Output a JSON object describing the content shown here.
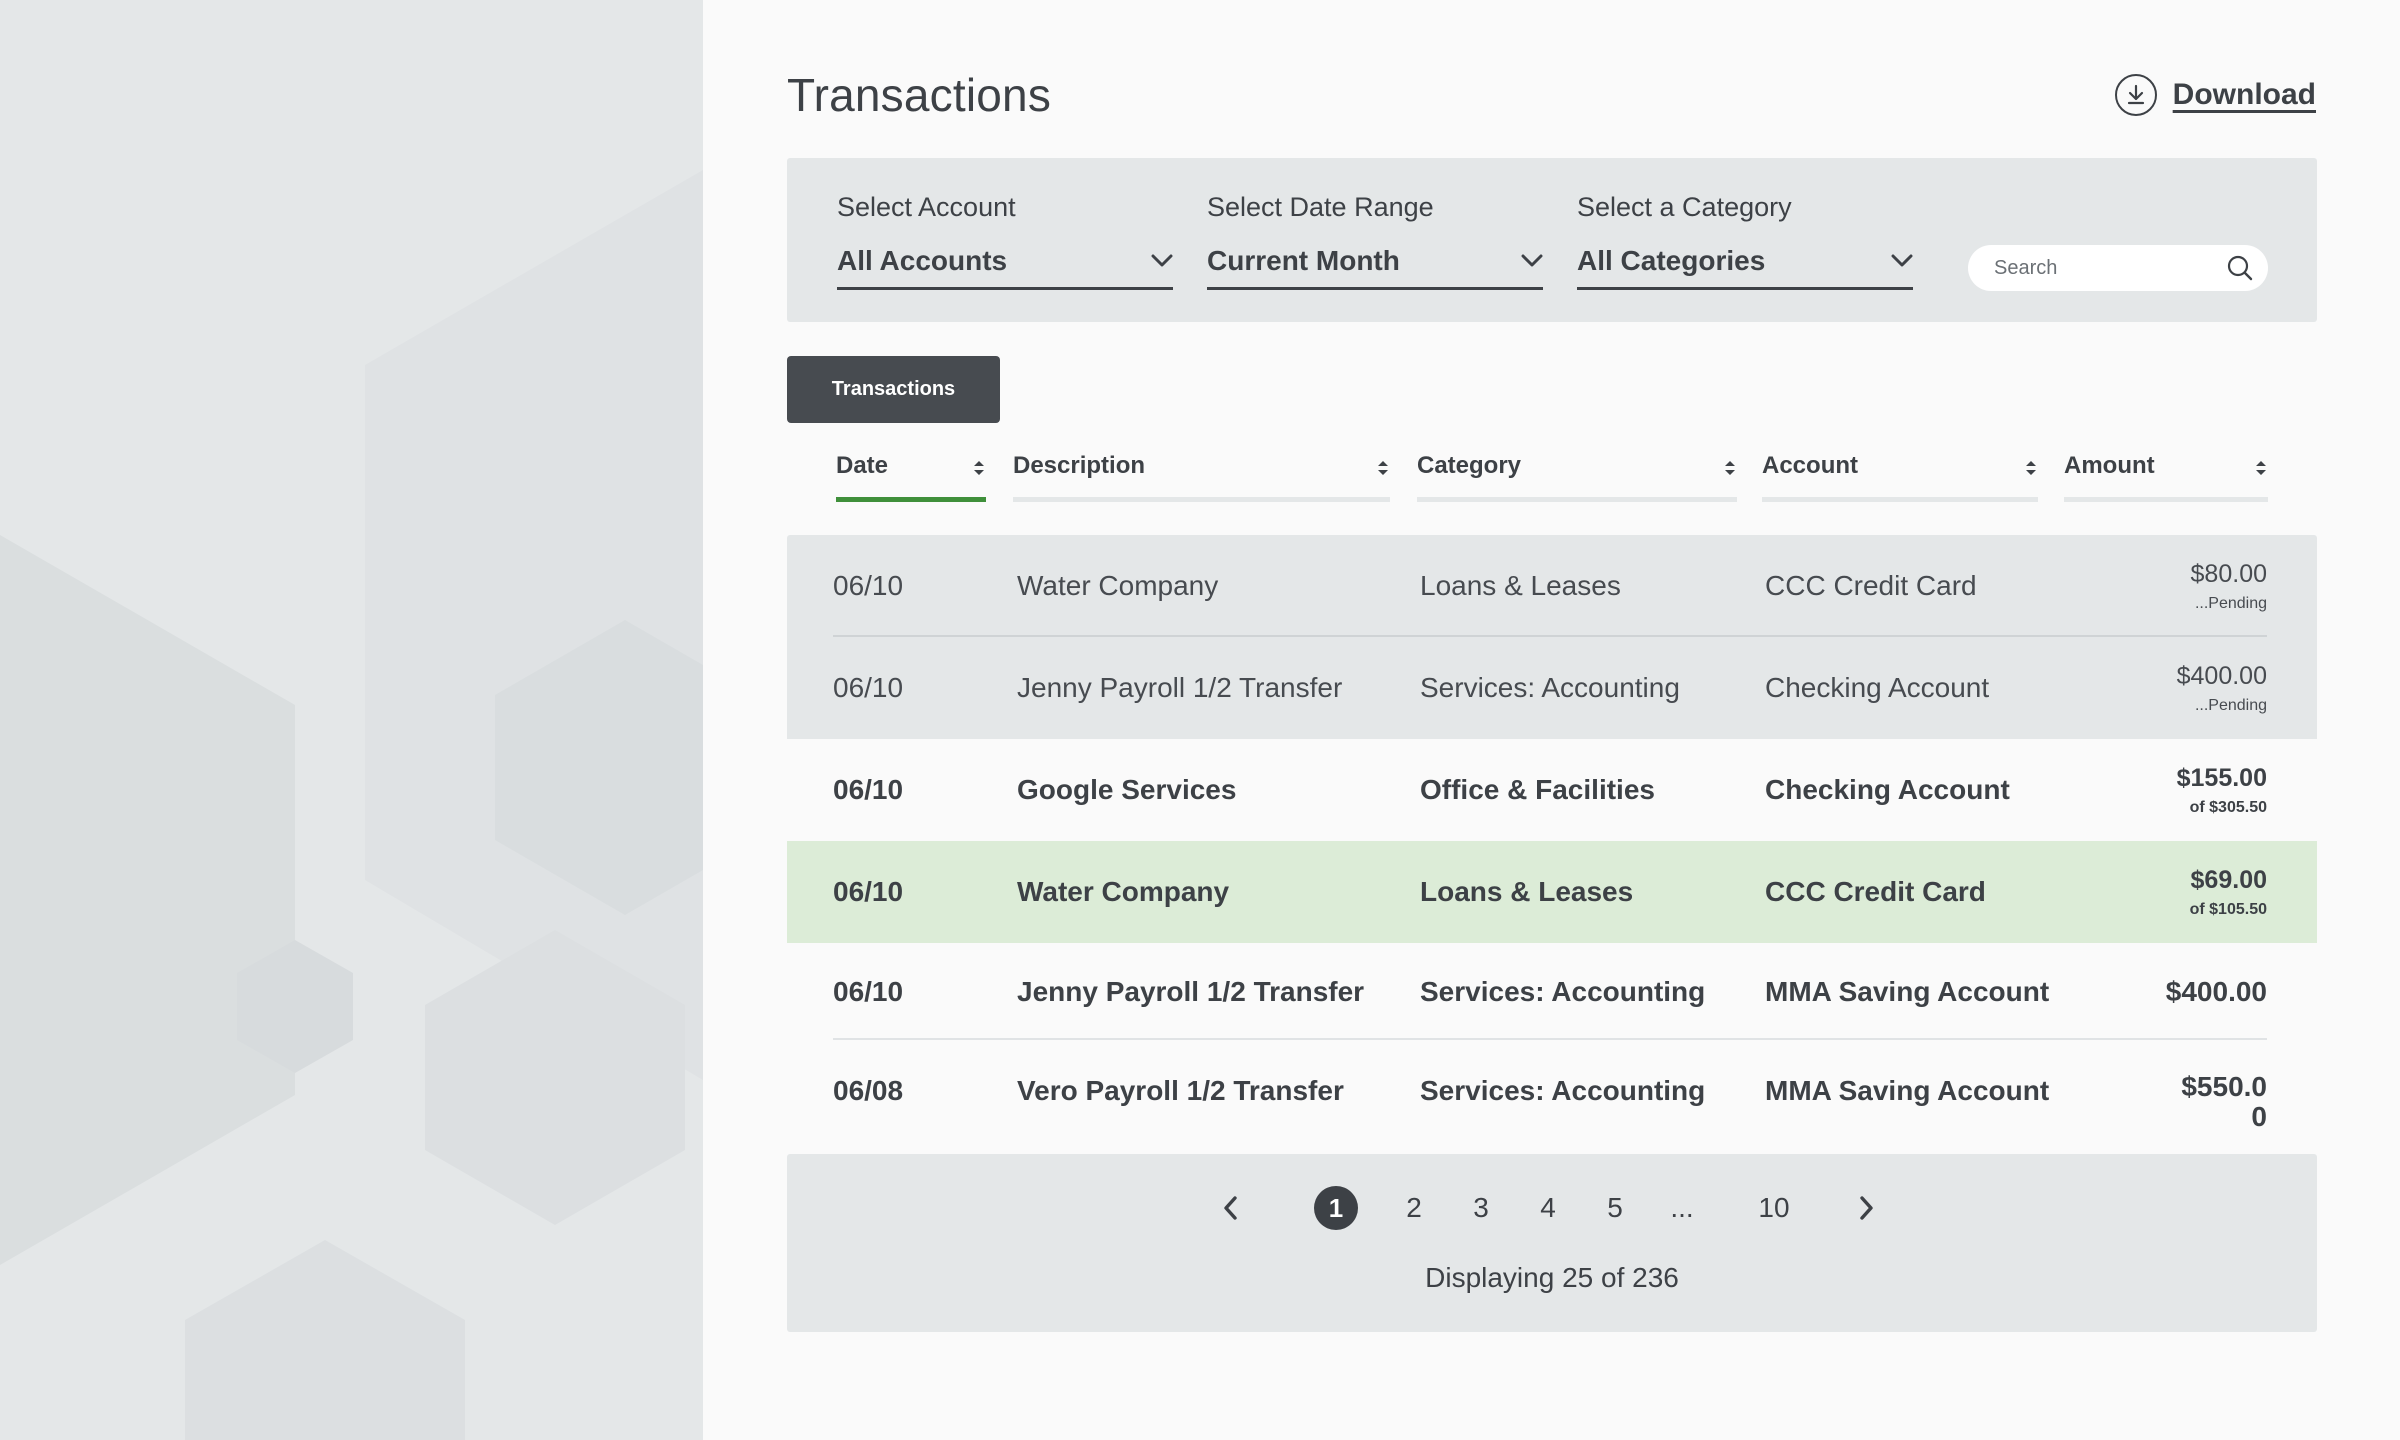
{
  "page": {
    "title": "Transactions",
    "download_label": "Download"
  },
  "filters": {
    "account": {
      "label": "Select Account",
      "value": "All Accounts"
    },
    "date_range": {
      "label": "Select Date Range",
      "value": "Current Month"
    },
    "category": {
      "label": "Select a Category",
      "value": "All Categories"
    },
    "search_placeholder": "Search"
  },
  "tab": {
    "label": "Transactions"
  },
  "columns": [
    "Date",
    "Description",
    "Category",
    "Account",
    "Amount"
  ],
  "rows": [
    {
      "date": "06/10",
      "description": "Water Company",
      "category": "Loans & Leases",
      "account": "CCC Credit Card",
      "amount": "$80.00",
      "sub": "...Pending"
    },
    {
      "date": "06/10",
      "description": "Jenny Payroll 1/2 Transfer",
      "category": "Services: Accounting",
      "account": "Checking Account",
      "amount": "$400.00",
      "sub": "...Pending"
    },
    {
      "date": "06/10",
      "description": "Google Services",
      "category": "Office & Facilities",
      "account": "Checking Account",
      "amount": "$155.00",
      "sub": "of $305.50"
    },
    {
      "date": "06/10",
      "description": "Water Company",
      "category": "Loans & Leases",
      "account": "CCC Credit Card",
      "amount": "$69.00",
      "sub": "of $105.50"
    },
    {
      "date": "06/10",
      "description": "Jenny Payroll 1/2 Transfer",
      "category": "Services: Accounting",
      "account": "MMA Saving Account",
      "amount": "$400.00",
      "sub": ""
    },
    {
      "date": "06/08",
      "description": "Vero Payroll 1/2 Transfer",
      "category": "Services: Accounting",
      "account": "MMA Saving Account",
      "amount": "$550.00",
      "sub": ""
    }
  ],
  "pagination": {
    "pages": [
      "1",
      "2",
      "3",
      "4",
      "5",
      "...",
      "10"
    ],
    "current": "1",
    "summary": "Displaying 25 of 236"
  },
  "colors": {
    "accent_green": "#3f8f3a",
    "highlight_row": "#dcecd7",
    "panel_gray": "#e4e7e8",
    "dark": "#3d4146"
  },
  "icons": {
    "download": "download-circle-icon",
    "chevron": "chevron-down-icon",
    "search": "search-icon",
    "sort": "sort-icon",
    "prev": "chevron-left-icon",
    "next": "chevron-right-icon"
  }
}
